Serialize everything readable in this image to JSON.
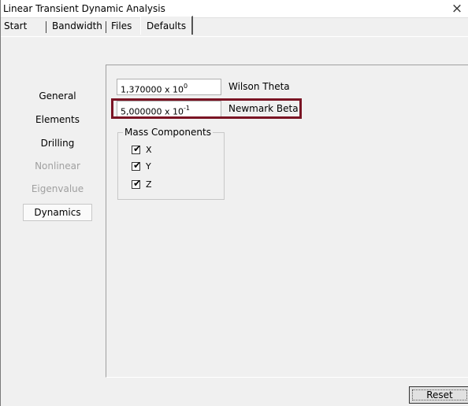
{
  "window": {
    "title": "Linear Transient Dynamic Analysis"
  },
  "tabs": [
    {
      "label": "Start"
    },
    {
      "label": "Bandwidth"
    },
    {
      "label": "Files"
    },
    {
      "label": "Defaults"
    }
  ],
  "active_tab": "Defaults",
  "sidebar": {
    "items": [
      {
        "label": "General",
        "enabled": true
      },
      {
        "label": "Elements",
        "enabled": true
      },
      {
        "label": "Drilling",
        "enabled": true
      },
      {
        "label": "Nonlinear",
        "enabled": false
      },
      {
        "label": "Eigenvalue",
        "enabled": false
      },
      {
        "label": "Dynamics",
        "enabled": true
      }
    ],
    "selected": "Dynamics"
  },
  "fields": {
    "wilson_theta": {
      "mantissa": "1,370000",
      "times": "x",
      "base": "10",
      "exponent": "0",
      "label": "Wilson Theta"
    },
    "newmark_beta": {
      "mantissa": "5,000000",
      "times": "x",
      "base": "10",
      "exponent": "-1",
      "label": "Newmark Beta"
    }
  },
  "mass_components": {
    "title": "Mass Components",
    "items": [
      {
        "label": "X",
        "checked": true
      },
      {
        "label": "Y",
        "checked": true
      },
      {
        "label": "Z",
        "checked": true
      }
    ]
  },
  "buttons": {
    "reset": "Reset"
  },
  "colors": {
    "highlight": "#7a1424"
  },
  "icons": {
    "close": "×",
    "check": "✔"
  }
}
